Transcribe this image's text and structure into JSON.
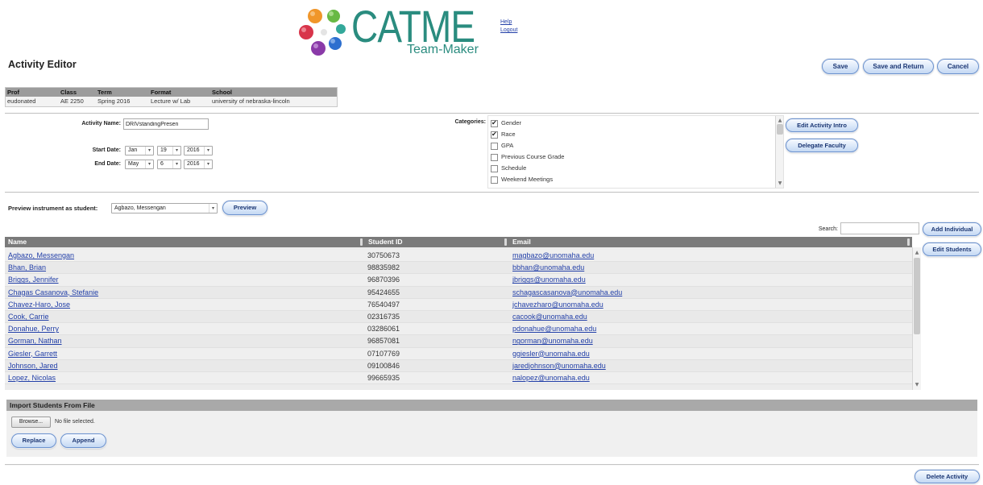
{
  "header": {
    "logo_title": "CATME",
    "logo_subtitle": "Team-Maker",
    "help_link": "Help",
    "logout_link": "Logout"
  },
  "page_title": "Activity Editor",
  "top_actions": {
    "save": "Save",
    "save_and_return": "Save and Return",
    "cancel": "Cancel"
  },
  "class_info": {
    "headers": {
      "prof": "Prof",
      "class": "Class",
      "term": "Term",
      "format": "Format",
      "school": "School"
    },
    "values": {
      "prof": "eudonated",
      "class": "AE 2250",
      "term": "Spring 2016",
      "format": "Lecture w/ Lab",
      "school": "university of nebraska-lincoln"
    }
  },
  "activity": {
    "name_label": "Activity Name:",
    "name_value": "DRIVstandingPresen",
    "start_label": "Start Date:",
    "start_month": "Jan",
    "start_day": "19",
    "start_year": "2016",
    "end_label": "End Date:",
    "end_month": "May",
    "end_day": "6",
    "end_year": "2016",
    "categories_label": "Categories:",
    "categories": [
      {
        "label": "Gender",
        "checked": true
      },
      {
        "label": "Race",
        "checked": true
      },
      {
        "label": "GPA",
        "checked": false
      },
      {
        "label": "Previous Course Grade",
        "checked": false
      },
      {
        "label": "Schedule",
        "checked": false
      },
      {
        "label": "Weekend Meetings",
        "checked": false
      }
    ]
  },
  "activity_actions": {
    "edit_intro": "Edit Activity Intro",
    "delegate_faculty": "Delegate Faculty"
  },
  "preview": {
    "label": "Preview instrument as student:",
    "selected_student": "Agbazo, Messengan",
    "button": "Preview"
  },
  "search": {
    "label": "Search:",
    "value": ""
  },
  "roster_actions": {
    "add_individual": "Add Individual",
    "edit_students": "Edit Students"
  },
  "roster": {
    "columns": {
      "name": "Name",
      "student_id": "Student ID",
      "email": "Email"
    },
    "rows": [
      {
        "name": "Agbazo, Messengan",
        "student_id": "30750673",
        "email": "magbazo@unomaha.edu"
      },
      {
        "name": "Bhan, Brian",
        "student_id": "98835982",
        "email": "bbhan@unomaha.edu"
      },
      {
        "name": "Briggs, Jennifer",
        "student_id": "96870396",
        "email": "jbriggs@unomaha.edu"
      },
      {
        "name": "Chagas Casanova, Stefanie",
        "student_id": "95424655",
        "email": "schagascasanova@unomaha.edu"
      },
      {
        "name": "Chavez-Haro, Jose",
        "student_id": "76540497",
        "email": "jchavezharo@unomaha.edu"
      },
      {
        "name": "Cook, Carrie",
        "student_id": "02316735",
        "email": "cacook@unomaha.edu"
      },
      {
        "name": "Donahue, Perry",
        "student_id": "03286061",
        "email": "pdonahue@unomaha.edu"
      },
      {
        "name": "Gorman, Nathan",
        "student_id": "96857081",
        "email": "ngorman@unomaha.edu"
      },
      {
        "name": "Giesler, Garrett",
        "student_id": "07107769",
        "email": "ggiesler@unomaha.edu"
      },
      {
        "name": "Johnson, Jared",
        "student_id": "09100846",
        "email": "jaredjohnson@unomaha.edu"
      },
      {
        "name": "Lopez, Nicolas",
        "student_id": "99665935",
        "email": "nalopez@unomaha.edu"
      }
    ]
  },
  "import": {
    "title": "Import Students From File",
    "browse_button": "Browse...",
    "file_status": "No file selected.",
    "replace_button": "Replace",
    "append_button": "Append"
  },
  "delete_button": "Delete Activity",
  "colors": {
    "brand_teal": "#2a8c7f",
    "link_blue": "#2340a8",
    "button_border": "#6d93cf",
    "table_header": "#7a7a7a"
  }
}
